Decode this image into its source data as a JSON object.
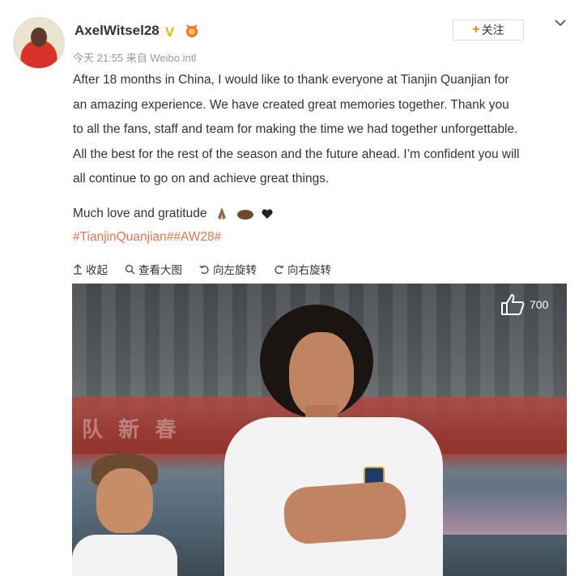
{
  "header": {
    "username": "AxelWitsel28",
    "verified_badge": "V",
    "meta": "今天 21:55 来自 Weibo.intl",
    "follow_label": "关注",
    "follow_plus": "+",
    "menu_icon": "chevron-down-icon"
  },
  "post": {
    "text": "After 18 months in China, I would like to thank everyone at Tianjin Quanjian for\nan amazing experience. We have created great memories together. Thank you\nto all the fans, staff and team for making the time we had together unforgettable.\nAll the best for the rest of the season and the future ahead. I’m confident you will\nall continue to go on and achieve great things.",
    "closing": "Much love and gratitude",
    "hashtag_1": "#TianjinQuanjian#",
    "hashtag_2": "#AW28#"
  },
  "toolbar": {
    "collapse": "收起",
    "view_large": "查看大图",
    "rotate_left": "向左旋转",
    "rotate_right": "向右旋转"
  },
  "photo": {
    "like_count": "700",
    "banner_text": "队 新 春"
  },
  "colors": {
    "hashtag": "#eb7350",
    "follow_plus": "#ff8200",
    "verified": "#f0b400"
  }
}
